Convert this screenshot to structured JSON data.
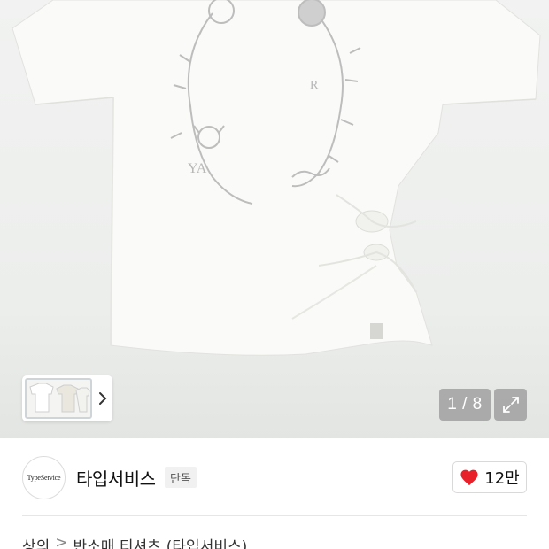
{
  "gallery": {
    "counter": "1 / 8",
    "current_page": 1,
    "total_pages": 8,
    "expand_icon": "expand-icon",
    "thumb_next_icon": "chevron-right-icon"
  },
  "brand": {
    "logo_text": "TypeService",
    "name": "타입서비스",
    "badge": "단독"
  },
  "like": {
    "icon": "heart-icon",
    "color": "#e8202a",
    "count": "12만"
  },
  "breadcrumb": {
    "items": [
      "상의",
      "반소매 티셔츠",
      "(타입서비스)"
    ],
    "separator": ">"
  }
}
